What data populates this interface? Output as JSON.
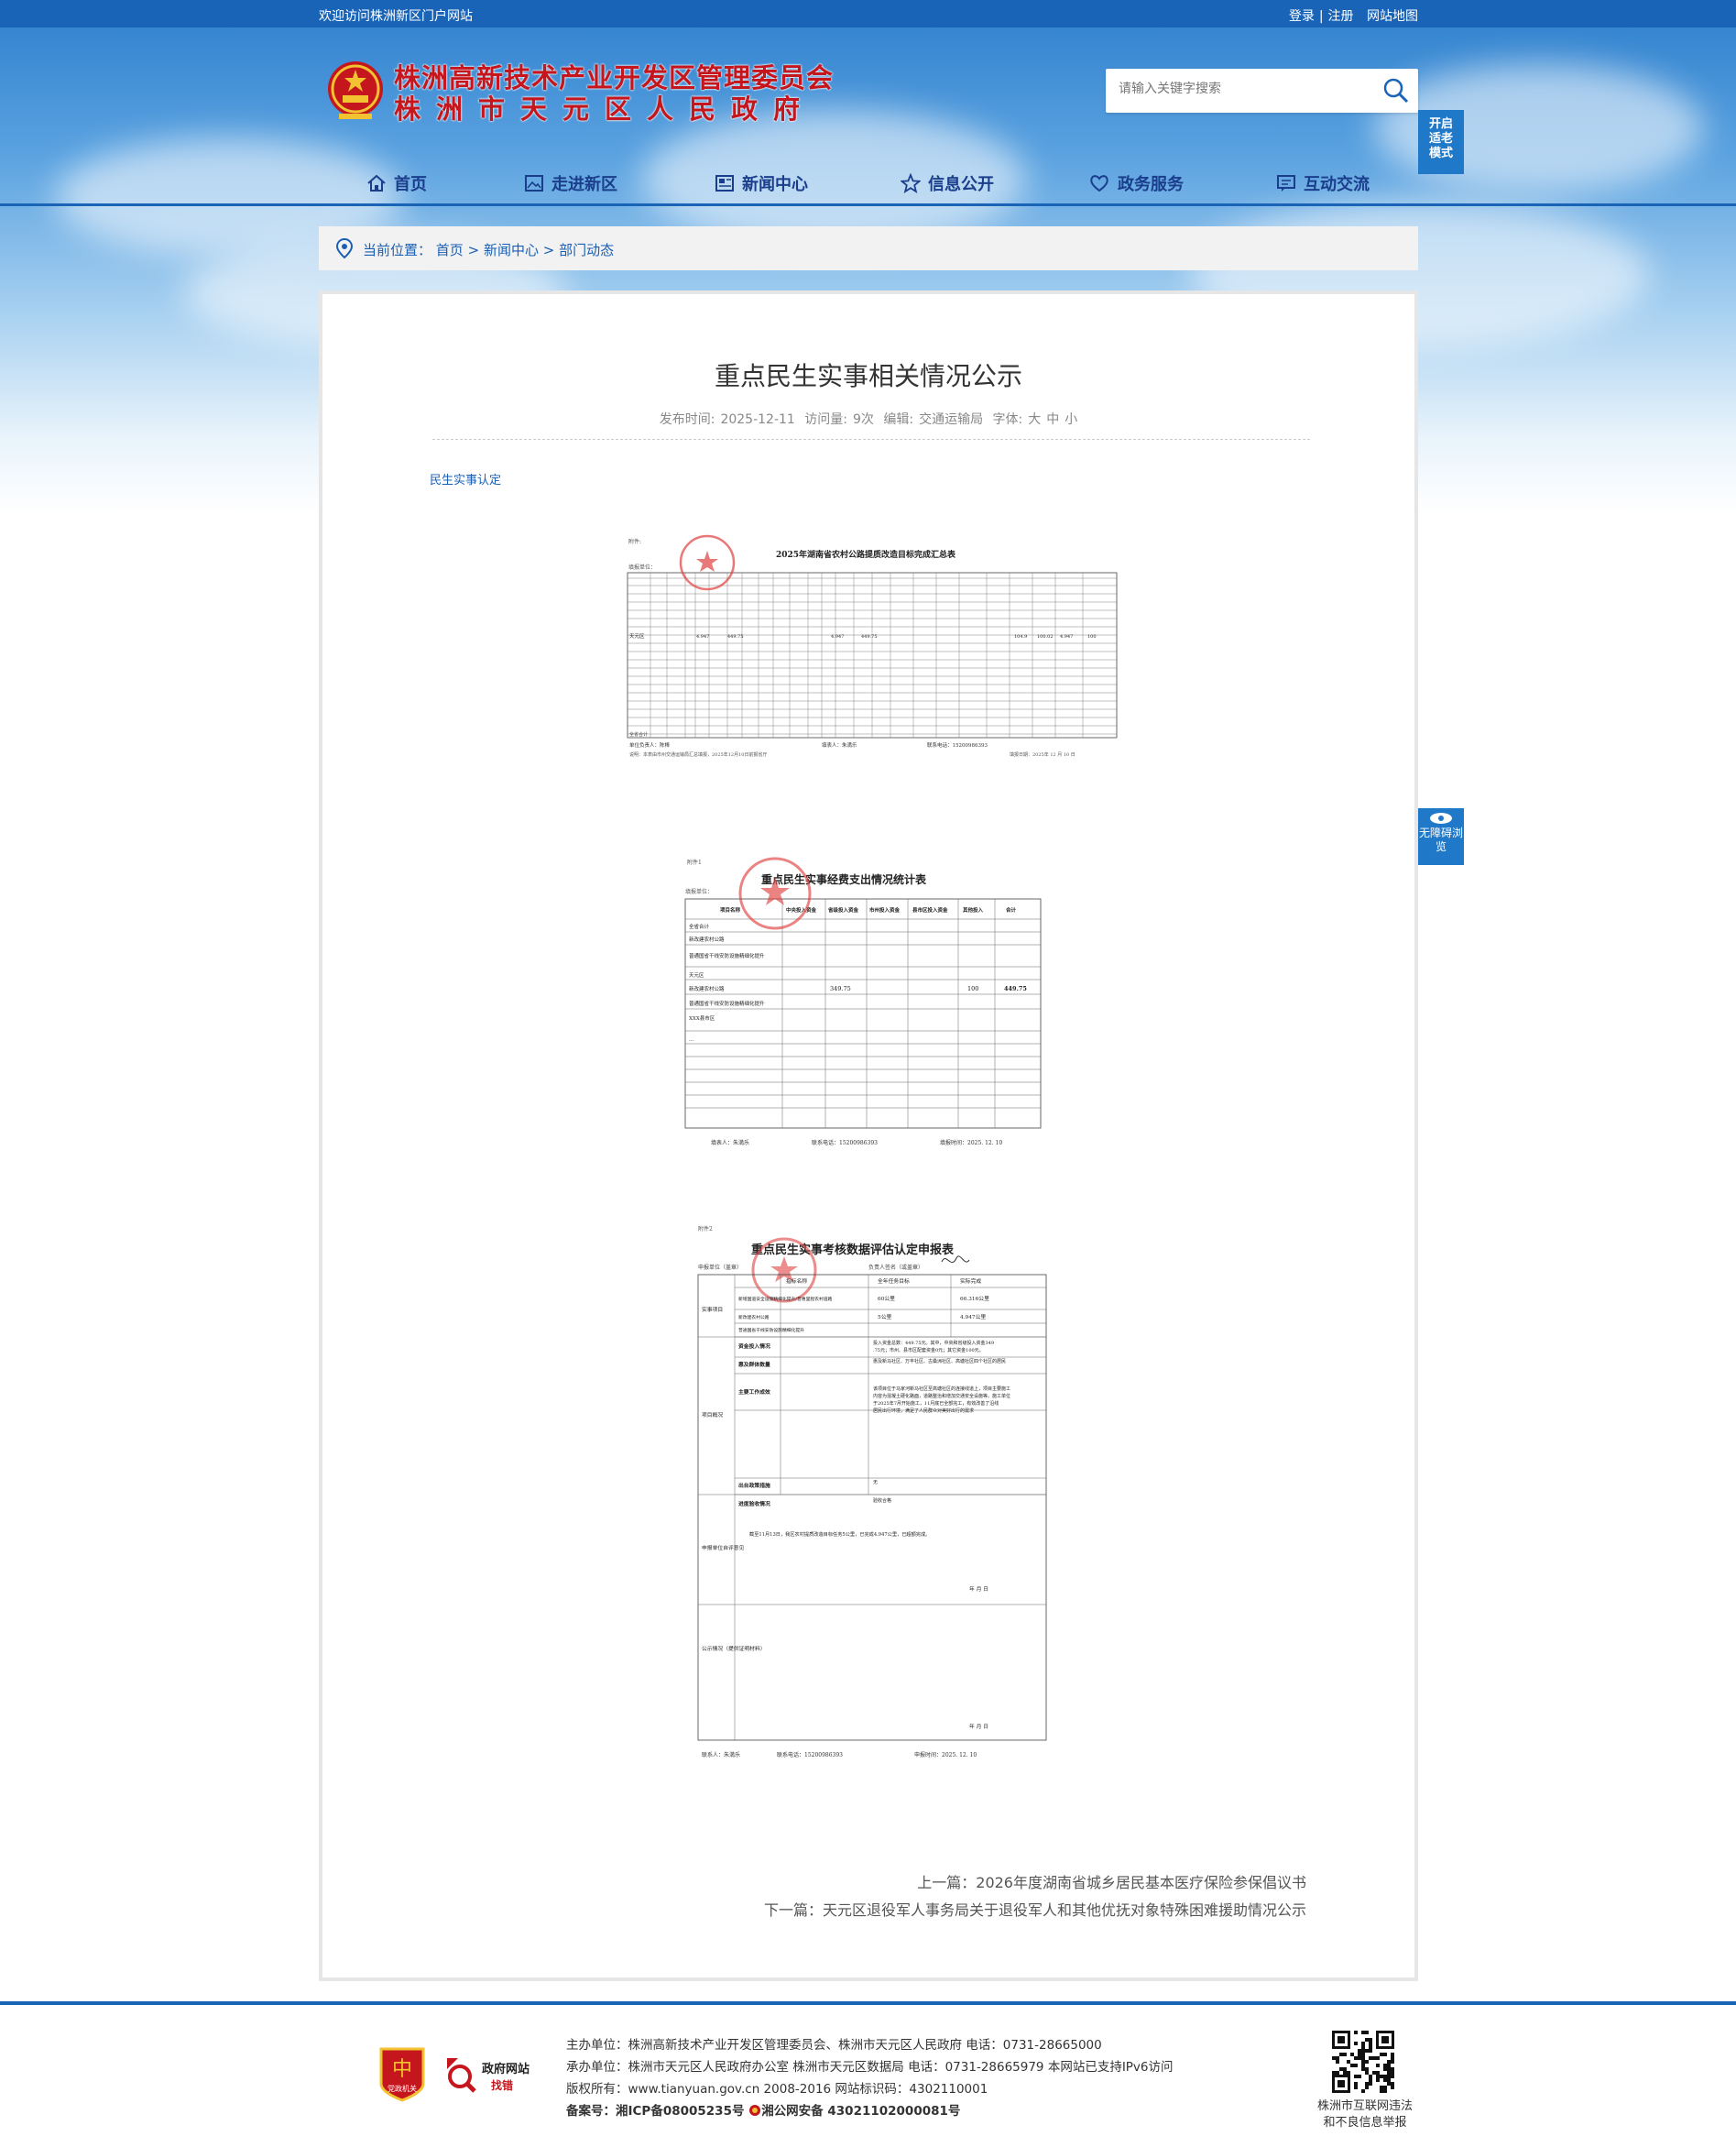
{
  "topbar": {
    "welcome": "欢迎访问株洲新区门户网站",
    "login": "登录",
    "sep": "|",
    "register": "注册",
    "sitemap": "网站地图"
  },
  "header": {
    "title_line1": "株洲高新技术产业开发区管理委员会",
    "title_line2": "株洲市天元区人民政府",
    "search_placeholder": "请输入关键字搜索",
    "elder_mode": "开启适老模式",
    "barrier_free": "无障碍浏览"
  },
  "nav": [
    {
      "label": "首页",
      "icon": "home-icon"
    },
    {
      "label": "走进新区",
      "icon": "picture-icon"
    },
    {
      "label": "新闻中心",
      "icon": "newspaper-icon"
    },
    {
      "label": "信息公开",
      "icon": "star-icon"
    },
    {
      "label": "政务服务",
      "icon": "heart-hand-icon"
    },
    {
      "label": "互动交流",
      "icon": "chat-icon"
    }
  ],
  "breadcrumb": {
    "label": "当前位置：",
    "items": [
      "首页",
      "新闻中心",
      "部门动态"
    ],
    "sep": ">"
  },
  "article": {
    "title": "重点民生实事相关情况公示",
    "meta": {
      "date_label": "发布时间:",
      "date": "2025-12-11",
      "views_label": "访问量:",
      "views": "9次",
      "editor_label": "编辑:",
      "editor": "交通运输局",
      "font_label": "字体:",
      "font_large": "大",
      "font_mid": "中",
      "font_small": "小"
    },
    "tag": "民生实事认定",
    "doc1": {
      "label": "附件:",
      "title": "2025年湖南省农村公路提质改造目标完成汇总表",
      "unit": "填报单位：",
      "area": "天元区",
      "row_values": [
        "4.947",
        "449.75",
        "4.947",
        "449.75",
        "104.9",
        "100.02",
        "4.947",
        "100"
      ],
      "footer_left": "单位负责人：陈棒",
      "footer_mid": "填表人：朱満乐",
      "footer_right": "联系电话：15200986393",
      "note": "说明：本表由市州交通运输局汇总填报，2025年12月10日前报省厅",
      "date": "填报日期：2025年 12 月 10 日",
      "total_label": "全省合计"
    },
    "doc2": {
      "label": "附件1",
      "title": "重点民生实事经费支出情况统计表",
      "unit": "填报单位：",
      "headers": [
        "项目名称",
        "中央投入资金",
        "省级投入资金",
        "市州投入资金",
        "县市区投入资金",
        "其他投入",
        "合计"
      ],
      "rows": [
        {
          "name": "全省合计"
        },
        {
          "name": "新改建农村公路"
        },
        {
          "name": "普通国省干线安防设施精细化提升"
        },
        {
          "name": "天元区"
        },
        {
          "name": "新改建农村公路",
          "prov": "349.75",
          "other": "100",
          "total": "449.75"
        },
        {
          "name": "普通国省干线安防设施精细化提升"
        },
        {
          "name": "XXX县市区"
        },
        {
          "name": "..."
        }
      ],
      "footer_left": "填表人：朱満乐",
      "footer_mid": "联系电话：15200986393",
      "footer_right": "填报时间：2025. 12. 10"
    },
    "doc3": {
      "label": "附件2",
      "title": "重点民生实事考核数据评估认定申报表",
      "unit": "申报单位（盖章）",
      "sig_label": "负责人签名（或盖章）",
      "col1": "指标名称",
      "col2": "全年任务目标",
      "col3": "实际完成",
      "section1": "实事项目",
      "tasks": [
        {
          "name": "新增国道安全设施精细化提升/普惠里程农村道路",
          "target": "60公里",
          "done": "66.316公里"
        },
        {
          "name": "新改建农村公路",
          "target": "5公里",
          "done": "4.947公里"
        },
        {
          "name": "普通国省干线安防设施精细化提升",
          "target": "",
          "done": ""
        }
      ],
      "section2": "项目概况",
      "details": [
        {
          "k": "资金投入情况",
          "v": "投入资金总数：449.75元。其中，中央和省级投入资金349.75元；市州、县市区配套资金0元；其它资金100元。"
        },
        {
          "k": "惠及群体数量",
          "v": "惠及新马社区、万丰社区、古桑洲社区、高塘社区四个社区的居民"
        },
        {
          "k": "主要工作成效",
          "v": "该项目位于马家河新马社区至高塘社区的连接线道上，项目主要施工内容为混凝土硬化路面，道路整治和增加交通安全设施等。施工单位于2025年7月开始施工，11月底已全部完工，有效改善了沿线居民出行环境，满足了人民群众对美好出行的需求"
        },
        {
          "k": "出台政策措施",
          "v": "无"
        },
        {
          "k": "进度验收情况",
          "v": "验收合格"
        }
      ],
      "section3": "申报单位自评意见",
      "self_eval": "截至11月13日，我区农村提质改造目标任务5公里，已完成4.947公里，已超额完成。",
      "date_mark": "年  月  日",
      "section4": "公示情况（提供证明材料）",
      "footer_left": "联系人：朱満乐",
      "footer_mid": "联系电话：15200986393",
      "footer_right": "申报时间：2025. 12. 10"
    },
    "prev_label": "上一篇：",
    "prev": "2026年度湖南省城乡居民基本医疗保险参保倡议书",
    "next_label": "下一篇：",
    "next": "天元区退役军人事务局关于退役军人和其他优抚对象特殊困难援助情况公示"
  },
  "footer": {
    "badge1": "党政机关",
    "badge2_line1": "政府网站",
    "badge2_line2": "找错",
    "line1_label": "主办单位：",
    "line1": "株洲高新技术产业开发区管理委员会、株洲市天元区人民政府 电话：0731-28665000",
    "line2_label": "承办单位：",
    "line2": "株洲市天元区人民政府办公室 株洲市天元区数据局 电话：0731-28665979 本网站已支持IPv6访问",
    "line3_label": "版权所有：",
    "line3": "www.tianyuan.gov.cn 2008-2016 网站标识码：4302110001",
    "line4_label": "备案号：",
    "line4a": "湘ICP备08005235号",
    "line4b": "湘公网安备 43021102000081号",
    "qr_caption1": "株洲市互联网违法",
    "qr_caption2": "和不良信息举报"
  },
  "colors": {
    "brand_blue": "#1a64b8",
    "title_red": "#c4161c",
    "nav_text": "#1a3e8c",
    "link_blue": "#1a5fb4"
  }
}
